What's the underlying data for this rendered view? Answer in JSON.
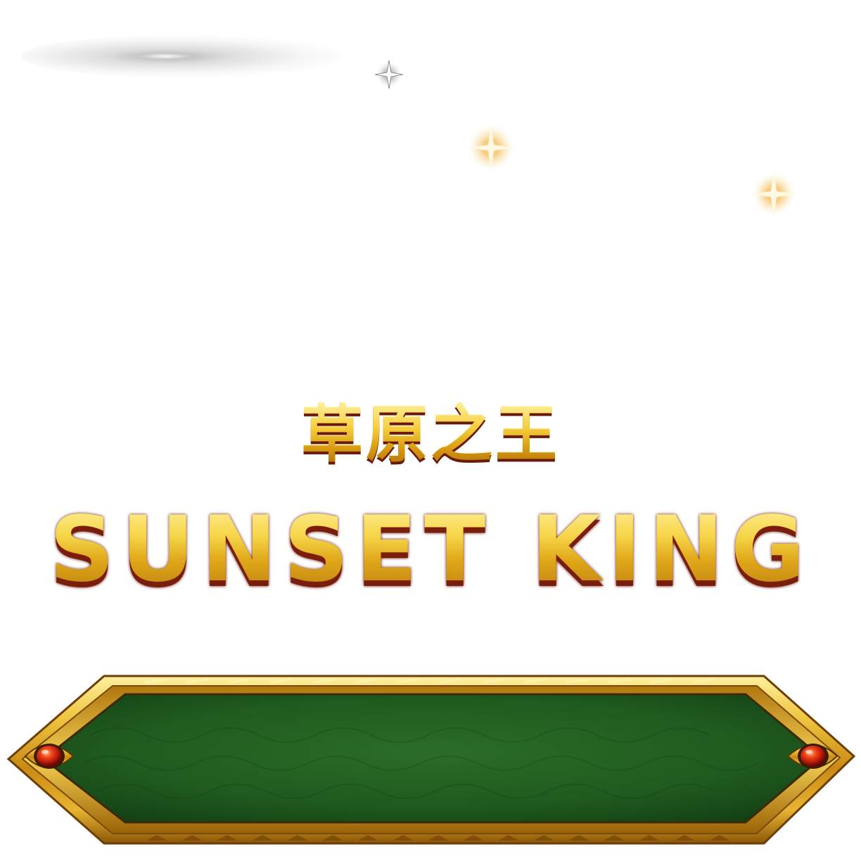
{
  "title": {
    "chinese": "草原之王",
    "english": "SUNSET KING"
  },
  "panel": {
    "label": ""
  },
  "colors": {
    "gold_light": "#fff2a0",
    "gold": "#e6b21f",
    "gold_dark": "#a86a08",
    "shadow_red": "#7a1d0a",
    "panel_green": "#1f5a20",
    "gem_red": "#d8280c",
    "sparkle_gold": "#f6c65a"
  },
  "icons": {
    "sparkles": [
      "sparkle-icon",
      "sparkle-icon",
      "sparkle-icon"
    ],
    "gems": [
      "ruby-gem-icon",
      "ruby-gem-icon"
    ]
  }
}
